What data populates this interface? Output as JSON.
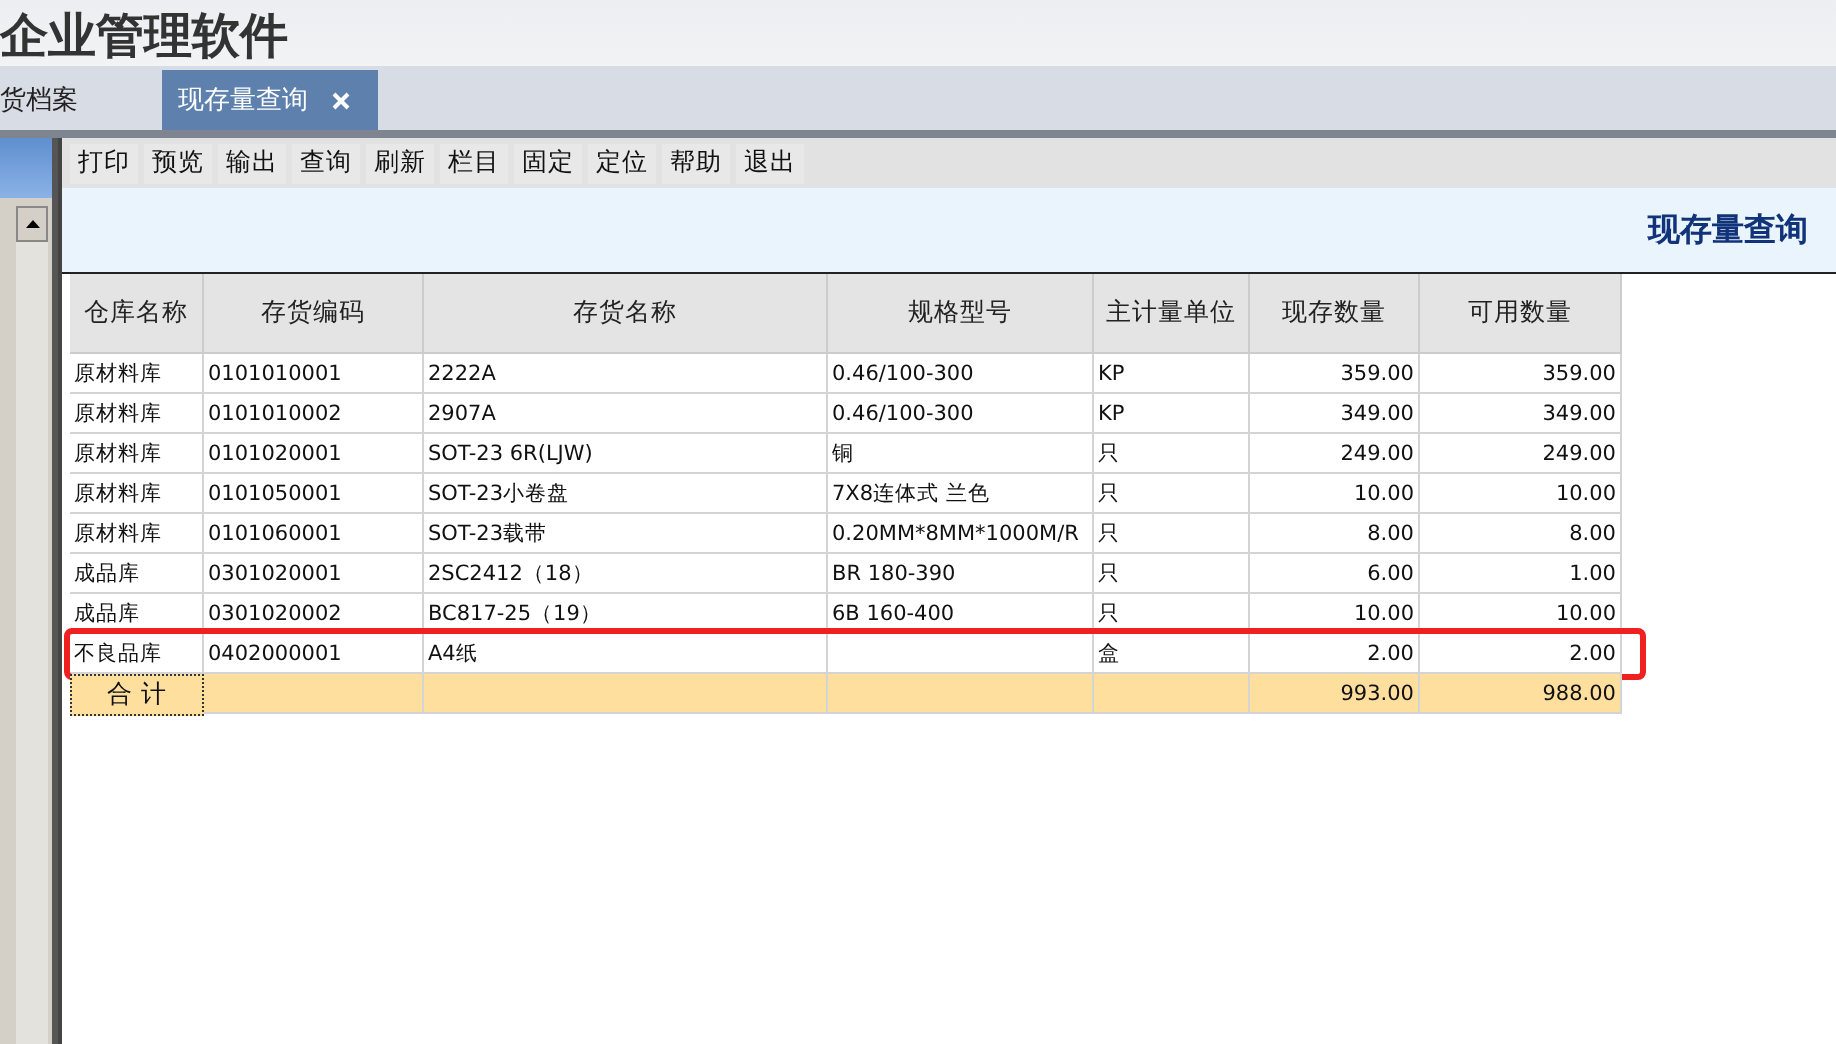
{
  "app_title": "企业管理软件",
  "tabs": [
    {
      "label": "货档案",
      "selected": false,
      "closable": false
    },
    {
      "label": "现存量查询",
      "selected": true,
      "closable": true
    }
  ],
  "toolbar": [
    "打印",
    "预览",
    "输出",
    "查询",
    "刷新",
    "栏目",
    "固定",
    "定位",
    "帮助",
    "退出"
  ],
  "report_title": "现存量查询",
  "table": {
    "columns": [
      {
        "label": "仓库名称",
        "kind": "text"
      },
      {
        "label": "存货编码",
        "kind": "text"
      },
      {
        "label": "存货名称",
        "kind": "text"
      },
      {
        "label": "规格型号",
        "kind": "text"
      },
      {
        "label": "主计量单位",
        "kind": "text"
      },
      {
        "label": "现存数量",
        "kind": "number"
      },
      {
        "label": "可用数量",
        "kind": "number"
      }
    ],
    "rows": [
      {
        "cells": [
          "原材料库",
          "0101010001",
          "2222A",
          "0.46/100-300",
          "KP",
          "359.00",
          "359.00"
        ],
        "highlighted": false
      },
      {
        "cells": [
          "原材料库",
          "0101010002",
          "2907A",
          "0.46/100-300",
          "KP",
          "349.00",
          "349.00"
        ],
        "highlighted": false
      },
      {
        "cells": [
          "原材料库",
          "0101020001",
          "SOT-23 6R(LJW)",
          "铜",
          "只",
          "249.00",
          "249.00"
        ],
        "highlighted": false
      },
      {
        "cells": [
          "原材料库",
          "0101050001",
          "SOT-23小卷盘",
          "7X8连体式 兰色",
          "只",
          "10.00",
          "10.00"
        ],
        "highlighted": false
      },
      {
        "cells": [
          "原材料库",
          "0101060001",
          "SOT-23载带",
          "0.20MM*8MM*1000M/R",
          "只",
          "8.00",
          "8.00"
        ],
        "highlighted": false
      },
      {
        "cells": [
          "成品库",
          "0301020001",
          "2SC2412（18）",
          "BR 180-390",
          "只",
          "6.00",
          "1.00"
        ],
        "highlighted": false
      },
      {
        "cells": [
          "成品库",
          "0301020002",
          "BC817-25（19）",
          "6B 160-400",
          "只",
          "10.00",
          "10.00"
        ],
        "highlighted": false
      },
      {
        "cells": [
          "不良品库",
          "0402000001",
          "A4纸",
          "",
          "盒",
          "2.00",
          "2.00"
        ],
        "highlighted": true
      }
    ],
    "total": {
      "label": "合 计",
      "cells": [
        "",
        "",
        "",
        "",
        "993.00",
        "988.00"
      ]
    }
  }
}
